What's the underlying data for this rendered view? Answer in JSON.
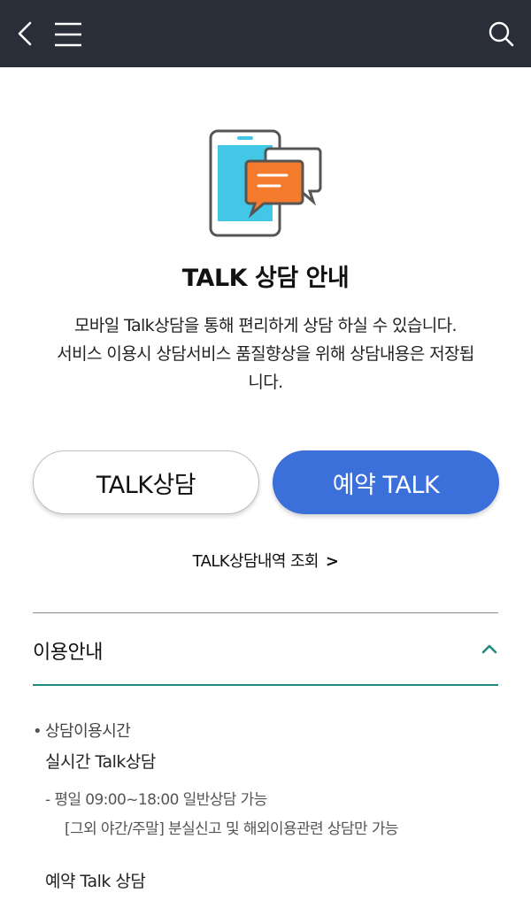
{
  "header": {
    "icons": [
      "back-arrow-icon",
      "hamburger-menu-icon",
      "search-icon"
    ],
    "background": "#292e38"
  },
  "hero": {
    "icon": "mobile-chat-icon",
    "title": "TALK 상담 안내",
    "description_lines": [
      "모바일 Talk상담을 통해 편리하게 상담 하실 수 있습니다.",
      "서비스 이용시 상담서비스 품질향상을 위해 상담내용은 저장됩",
      "니다."
    ]
  },
  "buttons": {
    "talk_label": "TALK상담",
    "reserve_label": "예약 TALK",
    "reserve_color": "#3b6fd9"
  },
  "history_link": {
    "label": "TALK상담내역 조회",
    "chevron": ">"
  },
  "usage_section": {
    "label": "이용안내",
    "expanded": true,
    "accent": "#1f8a7e",
    "bullet_label": "상담이용시간",
    "realtime_title": "실시간 Talk상담",
    "hours_line": "- 평일 09:00~18:00 일반상담 가능",
    "after_hours_line": "[그외 야간/주말] 분실신고 및 해외이용관련 상담만 가능",
    "reserve_title": "예약 Talk 상담"
  }
}
